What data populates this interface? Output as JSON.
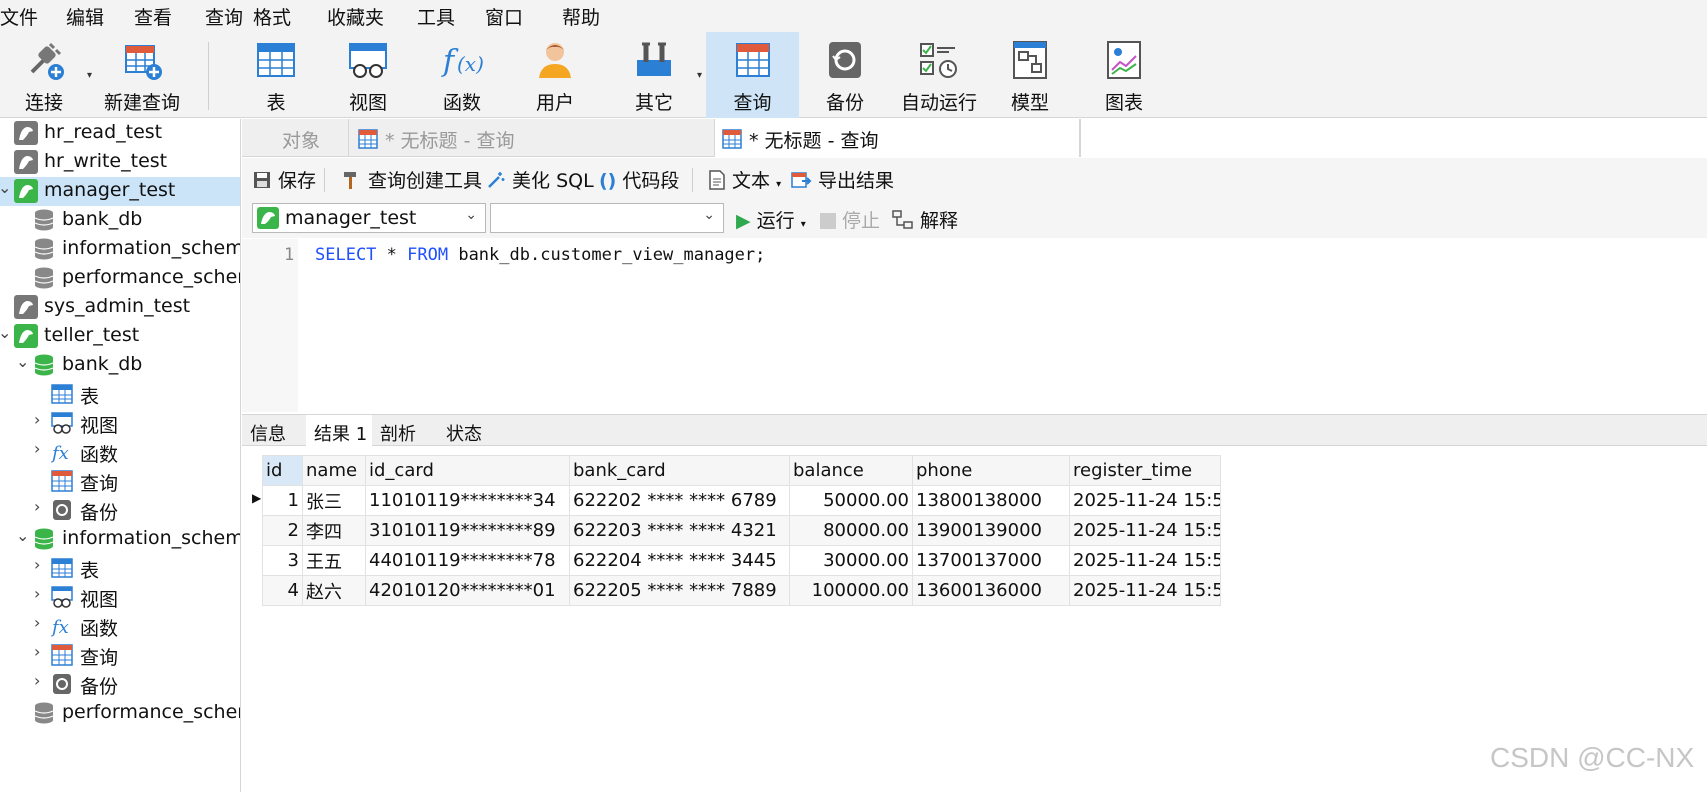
{
  "menu": [
    "文件",
    "编辑",
    "查看",
    "查询",
    "格式",
    "收藏夹",
    "工具",
    "窗口",
    "帮助"
  ],
  "toolbar": {
    "connect": "连接",
    "new_query": "新建查询",
    "table": "表",
    "view": "视图",
    "function": "函数",
    "user": "用户",
    "other": "其它",
    "query": "查询",
    "backup": "备份",
    "autorun": "自动运行",
    "model": "模型",
    "chart": "图表"
  },
  "sidebar": {
    "items": [
      {
        "label": "hr_read_test"
      },
      {
        "label": "hr_write_test"
      },
      {
        "label": "manager_test"
      },
      {
        "label": "bank_db"
      },
      {
        "label": "information_schema"
      },
      {
        "label": "performance_schema"
      },
      {
        "label": "sys_admin_test"
      },
      {
        "label": "teller_test"
      },
      {
        "label": "bank_db"
      },
      {
        "label": "表"
      },
      {
        "label": "视图"
      },
      {
        "label": "函数"
      },
      {
        "label": "查询"
      },
      {
        "label": "备份"
      },
      {
        "label": "information_schema"
      },
      {
        "label": "表"
      },
      {
        "label": "视图"
      },
      {
        "label": "函数"
      },
      {
        "label": "查询"
      },
      {
        "label": "备份"
      },
      {
        "label": "performance_schema"
      }
    ]
  },
  "tabs": {
    "objects": "对象",
    "tab1": "* 无标题 - 查询",
    "tab2": "* 无标题 - 查询"
  },
  "query_toolbar": {
    "save": "保存",
    "builder": "查询创建工具",
    "beautify": "美化 SQL",
    "snippet": "代码段",
    "text": "文本",
    "export": "导出结果"
  },
  "run_bar": {
    "connection": "manager_test",
    "database": "",
    "run": "运行",
    "stop": "停止",
    "explain": "解释"
  },
  "editor": {
    "line_number": "1",
    "kw1": "SELECT",
    "mid1": " * ",
    "kw2": "FROM",
    "rest": " bank_db.customer_view_manager;"
  },
  "result_tabs": [
    "信息",
    "结果 1",
    "剖析",
    "状态"
  ],
  "grid": {
    "columns": [
      "id",
      "name",
      "id_card",
      "bank_card",
      "balance",
      "phone",
      "register_time"
    ],
    "rows": [
      [
        "1",
        "张三",
        "11010119********34",
        "622202 **** **** 6789",
        "50000.00",
        "13800138000",
        "2025-11-24 15:5"
      ],
      [
        "2",
        "李四",
        "31010119********89",
        "622203 **** **** 4321",
        "80000.00",
        "13900139000",
        "2025-11-24 15:5"
      ],
      [
        "3",
        "王五",
        "44010119********78",
        "622204 **** **** 3445",
        "30000.00",
        "13700137000",
        "2025-11-24 15:5"
      ],
      [
        "4",
        "赵六",
        "42010120********01",
        "622205 **** **** 7889",
        "100000.00",
        "13600136000",
        "2025-11-24 15:5"
      ]
    ]
  },
  "watermark": "CSDN @CC-NX",
  "colors": {
    "accent": "#1f4fff",
    "selected": "#cce4f7",
    "active_tool": "#cfe5f7",
    "mysql_green": "#3bb54a"
  }
}
